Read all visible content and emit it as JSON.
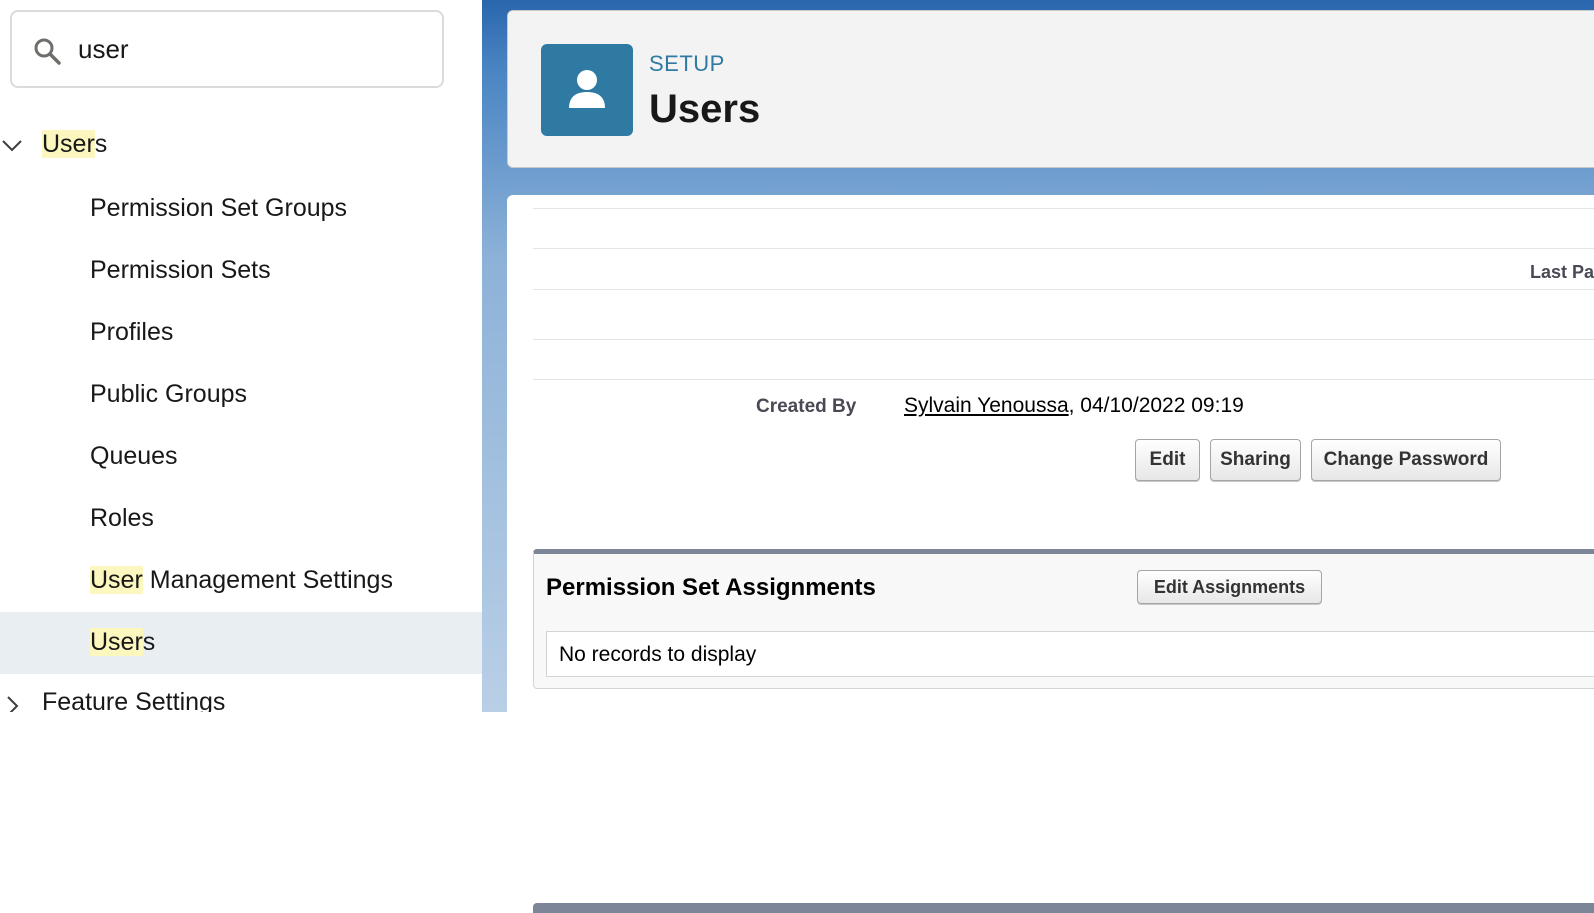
{
  "sidebar": {
    "search_value": "user",
    "tree": {
      "parent_match": "User",
      "parent_rest": "s",
      "items": [
        {
          "match": "",
          "rest": "Permission Set Groups"
        },
        {
          "match": "",
          "rest": "Permission Sets"
        },
        {
          "match": "",
          "rest": "Profiles"
        },
        {
          "match": "",
          "rest": "Public Groups"
        },
        {
          "match": "",
          "rest": "Queues"
        },
        {
          "match": "",
          "rest": "Roles"
        },
        {
          "match": "User",
          "rest": " Management Settings"
        },
        {
          "match": "User",
          "rest": "s"
        }
      ],
      "next_section": "Feature Settings"
    }
  },
  "header": {
    "eyebrow": "SETUP",
    "title": "Users",
    "icon": "user-icon"
  },
  "detail": {
    "last_label_partial": "Last Pa",
    "created_by_label": "Created By",
    "created_by_name": "Sylvain Yenoussa",
    "created_by_date": ", 04/10/2022 09:19",
    "buttons": {
      "edit": "Edit",
      "sharing": "Sharing",
      "change_password": "Change Password"
    }
  },
  "permission_set_assignments": {
    "title": "Permission Set Assignments",
    "edit_button": "Edit Assignments",
    "empty_text": "No records to display"
  },
  "colors": {
    "accent": "#2e7aa3",
    "highlight": "#fcf7bf",
    "selected_row": "#e8eef2"
  }
}
